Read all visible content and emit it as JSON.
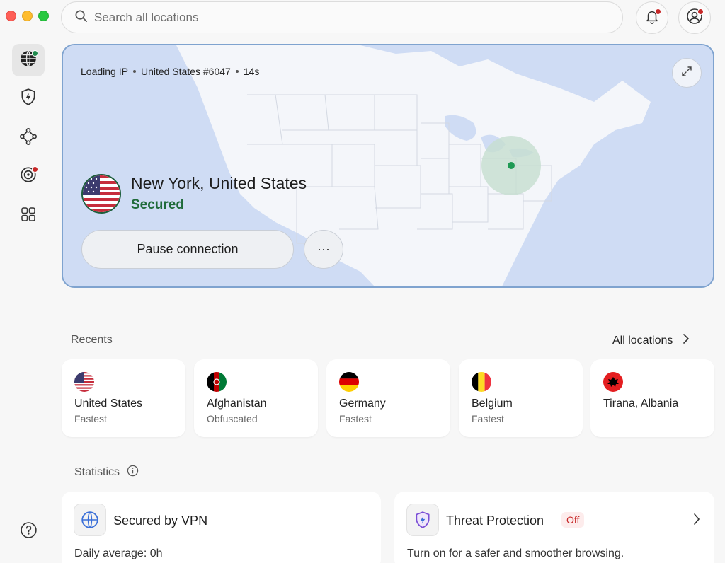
{
  "search": {
    "placeholder": "Search all locations"
  },
  "map": {
    "status": {
      "ip": "Loading IP",
      "server": "United States #6047",
      "time": "14s"
    },
    "location": "New York, United States",
    "connection_status": "Secured",
    "pause_label": "Pause connection",
    "more_label": "···"
  },
  "recents": {
    "title": "Recents",
    "all_label": "All locations",
    "items": [
      {
        "name": "United States",
        "sub": "Fastest",
        "flag": "us-flag-icon"
      },
      {
        "name": "Afghanistan",
        "sub": "Obfuscated",
        "flag": "af-flag-icon"
      },
      {
        "name": "Germany",
        "sub": "Fastest",
        "flag": "de-flag-icon"
      },
      {
        "name": "Belgium",
        "sub": "Fastest",
        "flag": "be-flag-icon"
      },
      {
        "name": "Tirana, Albania",
        "sub": "",
        "flag": "al-flag-icon"
      }
    ]
  },
  "statistics": {
    "title": "Statistics",
    "vpn": {
      "title": "Secured by VPN",
      "text_label": "Daily average: ",
      "text_value": "0h"
    },
    "threat": {
      "title": "Threat Protection",
      "badge": "Off",
      "text": "Turn on for a safer and smoother browsing."
    }
  },
  "colors": {
    "accent_green": "#1f6b3a",
    "map_border": "#7fa3cf",
    "alert_red": "#c62828"
  }
}
